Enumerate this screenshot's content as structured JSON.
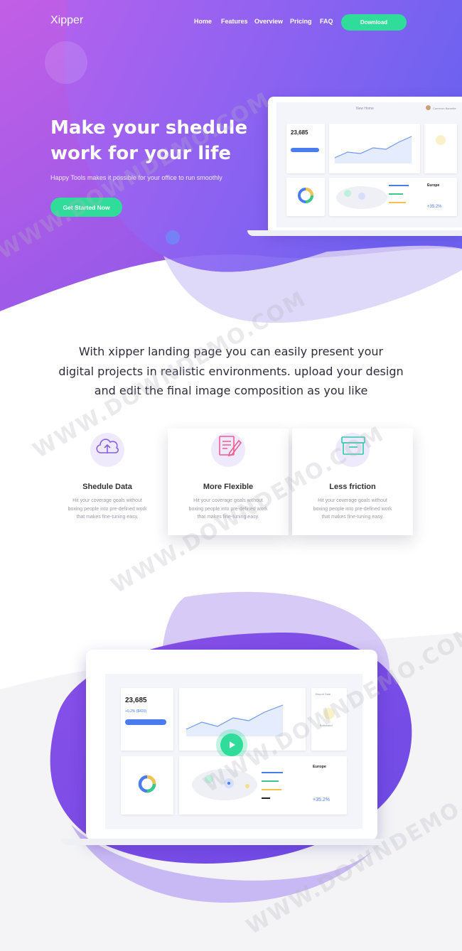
{
  "brand": {
    "name": "Xipper"
  },
  "nav": {
    "items": [
      "Home",
      "Features",
      "Overview",
      "Pricing",
      "FAQ"
    ],
    "download_label": "Download"
  },
  "hero": {
    "title_line1": "Make your shedule",
    "title_line2": "work for your life",
    "subtitle": "Happy Tools makes it possible for your office to run smoothly",
    "cta_label": "Get Started Now"
  },
  "dashboard": {
    "top_label": "New Home",
    "user_name": "Cameron Barnette",
    "balance": "23,685",
    "change": "+0.2% ($420)",
    "region_title": "Europe",
    "region_value": "+35.2%",
    "region_card_title": "Report Sale",
    "region_card_name": "Botswand"
  },
  "intro": {
    "line1": "With xipper landing page you can easily present your",
    "line2": "digital projects in realistic environments. upload your design",
    "line3": "and edit the final image composition as you like"
  },
  "features": [
    {
      "title": "Shedule Data",
      "icon": "cloud-upload-icon",
      "desc_line1": "Hit your coverage goals without",
      "desc_line2": "boxing people into pre-defined work",
      "desc_line3": "that makes fine-tuning easy."
    },
    {
      "title": "More Flexible",
      "icon": "document-pen-icon",
      "desc_line1": "Hit your coverage goals without",
      "desc_line2": "boxing people into pre-defined work",
      "desc_line3": "that makes fine-tuning easy."
    },
    {
      "title": "Less friction",
      "icon": "inbox-tray-icon",
      "desc_line1": "Hit your coverage goals without",
      "desc_line2": "boxing people into pre-defined work",
      "desc_line3": "that makes fine-tuning easy."
    }
  ],
  "watermark": "WWW.DOWNDEMO.COM",
  "colors": {
    "purple_start": "#a65ff0",
    "purple_end": "#6a5df5",
    "accent_green": "#2fdc9a",
    "feature_icon_1": "#8a5fe0",
    "feature_icon_2": "#ee5d8d",
    "feature_icon_3": "#2fc9a8"
  }
}
